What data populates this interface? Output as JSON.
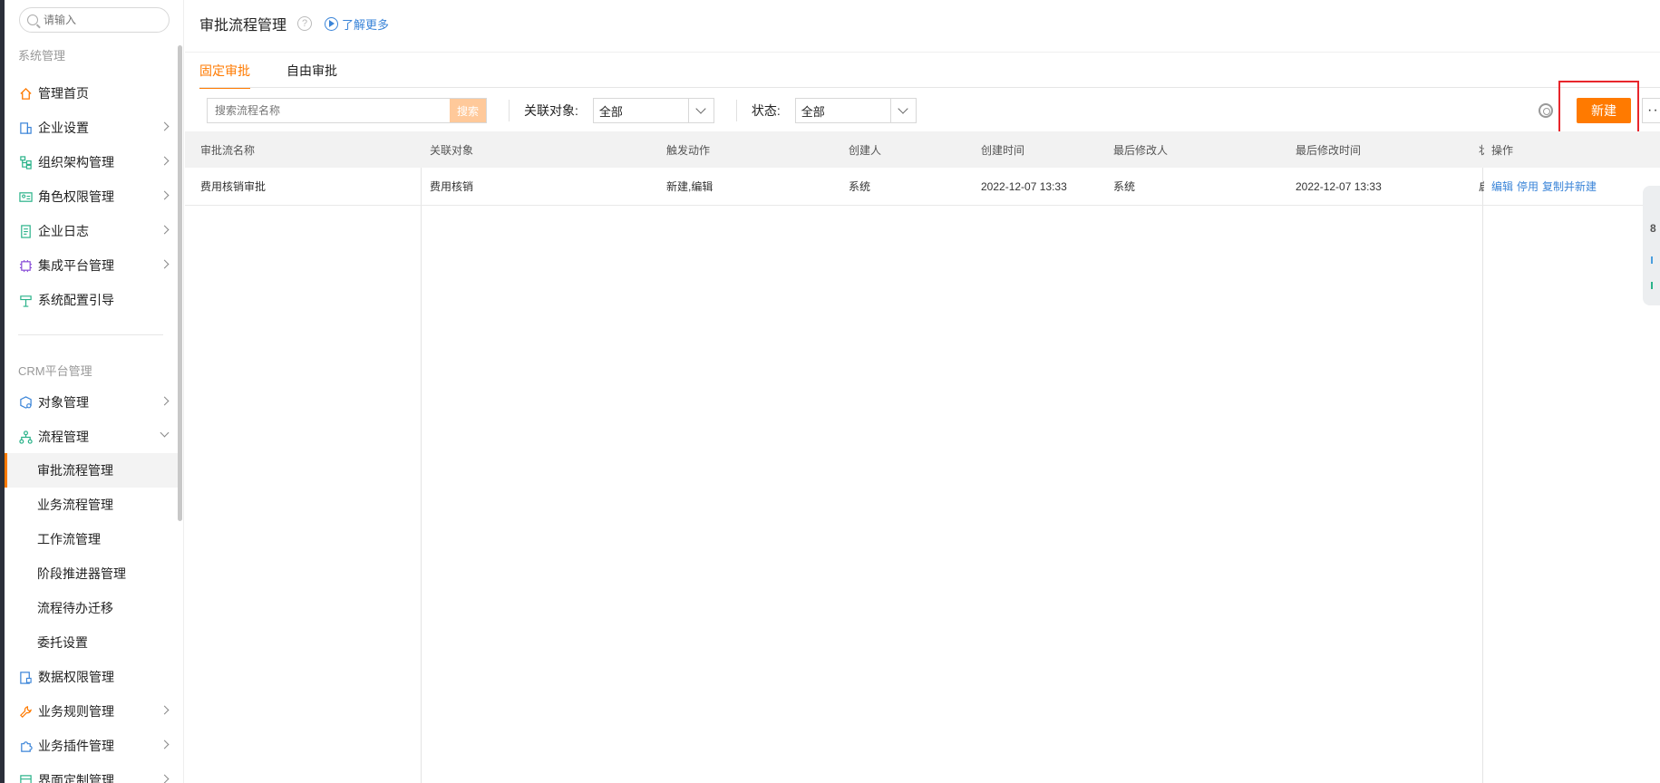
{
  "sidebar": {
    "search_placeholder": "请输入",
    "section1_title": "系统管理",
    "section1_items": [
      {
        "label": "管理首页",
        "icon": "home-icon",
        "expandable": false
      },
      {
        "label": "企业设置",
        "icon": "building-icon",
        "expandable": true
      },
      {
        "label": "组织架构管理",
        "icon": "org-tree-icon",
        "expandable": true
      },
      {
        "label": "角色权限管理",
        "icon": "id-card-icon",
        "expandable": true
      },
      {
        "label": "企业日志",
        "icon": "document-icon",
        "expandable": true
      },
      {
        "label": "集成平台管理",
        "icon": "chip-icon",
        "expandable": true
      },
      {
        "label": "系统配置引导",
        "icon": "signpost-icon",
        "expandable": false
      }
    ],
    "section2_title": "CRM平台管理",
    "section2_items": [
      {
        "label": "对象管理",
        "icon": "cube-gear-icon",
        "expandable": true
      },
      {
        "label": "流程管理",
        "icon": "flow-icon",
        "expandable": true,
        "expanded": true
      }
    ],
    "flow_subitems": [
      {
        "label": "审批流程管理",
        "active": true
      },
      {
        "label": "业务流程管理"
      },
      {
        "label": "工作流管理"
      },
      {
        "label": "阶段推进器管理"
      },
      {
        "label": "流程待办迁移"
      },
      {
        "label": "委托设置"
      }
    ],
    "section2_items_after": [
      {
        "label": "数据权限管理",
        "icon": "data-lock-icon",
        "expandable": false
      },
      {
        "label": "业务规则管理",
        "icon": "wrench-icon",
        "expandable": true
      },
      {
        "label": "业务插件管理",
        "icon": "puzzle-icon",
        "expandable": true
      },
      {
        "label": "界面定制管理",
        "icon": "layout-icon",
        "expandable": true
      }
    ]
  },
  "header": {
    "title": "审批流程管理",
    "help_symbol": "?",
    "learn_more": "了解更多"
  },
  "tabs": [
    {
      "label": "固定审批",
      "active": true
    },
    {
      "label": "自由审批",
      "active": false
    }
  ],
  "toolbar": {
    "search_placeholder": "搜索流程名称",
    "search_button": "搜索",
    "related_label": "关联对象:",
    "related_value": "全部",
    "status_label": "状态:",
    "status_value": "全部",
    "new_button": "新建",
    "more_button": "···"
  },
  "table": {
    "columns": [
      "审批流名称",
      "关联对象",
      "触发动作",
      "创建人",
      "创建时间",
      "最后修改人",
      "最后修改时间",
      "状",
      "操作"
    ],
    "rows": [
      {
        "name": "费用核销审批",
        "object": "费用核销",
        "trigger": "新建,编辑",
        "creator": "系统",
        "created": "2022-12-07 13:33",
        "modifier": "系统",
        "modified": "2022-12-07 13:33",
        "status": "启",
        "ops": [
          "编辑",
          "停用",
          "复制并新建"
        ]
      }
    ]
  },
  "float_panel": {
    "label": "8"
  },
  "colors": {
    "accent": "#ff7a00",
    "link": "#3a84d8",
    "highlight": "#e8262c"
  }
}
